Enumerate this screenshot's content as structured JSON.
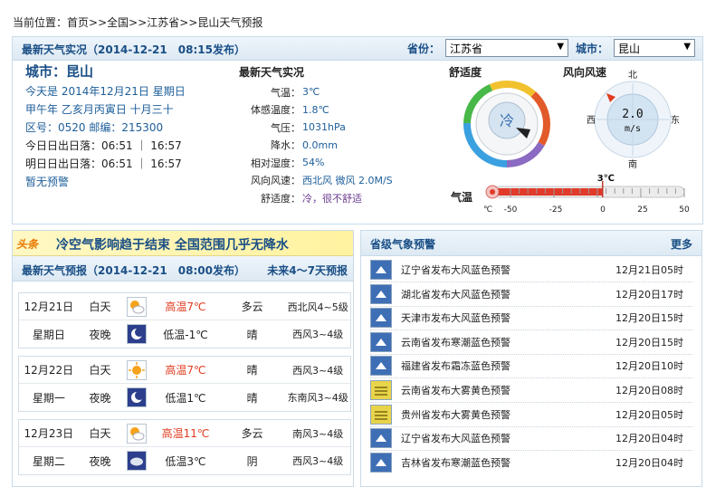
{
  "breadcrumb": {
    "prefix": "当前位置：",
    "items": [
      "首页",
      "全国",
      "江苏省",
      "昆山天气预报"
    ],
    "separator": ">>"
  },
  "current": {
    "title": "最新天气实况（2014-12-21　08:15发布）",
    "province_label": "省份：",
    "province_value": "江苏省",
    "city_label": "城市：",
    "city_value": "昆山",
    "city_heading": "城市：昆山",
    "today": "今天是 2014年12月21日 星期日",
    "lunar": "甲午年 乙亥月丙寅日 十月三十",
    "codes": "区号：0520  邮编：215300",
    "today_sun": "今日日出日落：06:51 ｜ 16:57",
    "tomorrow_sun": "明日日出日落：06:51 ｜ 16:57",
    "warning": "暂无预警",
    "obs_title": "最新天气实况",
    "obs": [
      {
        "k": "气温：",
        "v": "3℃"
      },
      {
        "k": "体感温度：",
        "v": "1.8℃"
      },
      {
        "k": "气压：",
        "v": "1031hPa"
      },
      {
        "k": "降水：",
        "v": "0.0mm"
      },
      {
        "k": "相对湿度：",
        "v": "54%"
      },
      {
        "k": "风向风速：",
        "v": "西北风 微风 2.0M/S"
      },
      {
        "k": "舒适度：",
        "v": "冷，很不舒适"
      }
    ],
    "comfort_title": "舒适度",
    "comfort_value": "冷",
    "wind_title": "风向风速",
    "wind_speed": "2.0",
    "wind_unit": "m/s",
    "compass": {
      "n": "北",
      "s": "南",
      "e": "东",
      "w": "西"
    },
    "temp_title": "气温",
    "temp_value": "3℃",
    "temp_level": 3,
    "temp_axis": [
      "℃",
      "-50",
      "-25",
      "0",
      "25",
      "50"
    ]
  },
  "news": {
    "tag": "头条",
    "headline": "冷空气影响趋于结束  全国范围几乎无降水"
  },
  "forecast": {
    "title": "最新天气预报（2014-12-21　08:00发布）",
    "more": "未来4～7天预报",
    "days": [
      {
        "date": "12月21日",
        "weekday": "星期日",
        "d": {
          "label": "白天",
          "icon": "partly-cloudy-icon",
          "temp": "高温7℃",
          "wx": "多云",
          "wind": "西北风4~5级"
        },
        "n": {
          "label": "夜晚",
          "icon": "moon-icon",
          "temp": "低温-1℃",
          "wx": "晴",
          "wind": "西风3~4级"
        }
      },
      {
        "date": "12月22日",
        "weekday": "星期一",
        "d": {
          "label": "白天",
          "icon": "sun-icon",
          "temp": "高温7℃",
          "wx": "晴",
          "wind": "西风3~4级"
        },
        "n": {
          "label": "夜晚",
          "icon": "moon-icon",
          "temp": "低温1℃",
          "wx": "晴",
          "wind": "东南风3~4级"
        }
      },
      {
        "date": "12月23日",
        "weekday": "星期二",
        "d": {
          "label": "白天",
          "icon": "partly-cloudy-icon",
          "temp": "高温11℃",
          "wx": "多云",
          "wind": "南风3~4级"
        },
        "n": {
          "label": "夜晚",
          "icon": "cloudy-night-icon",
          "temp": "低温3℃",
          "wx": "阴",
          "wind": "西风3~4级"
        }
      }
    ]
  },
  "alerts": {
    "title": "省级气象预警",
    "more": "更多",
    "items": [
      {
        "text": "辽宁省发布大风蓝色预警",
        "date": "12月21日05时",
        "icon": "wind-warning-icon"
      },
      {
        "text": "湖北省发布大风蓝色预警",
        "date": "12月20日17时",
        "icon": "wind-warning-icon"
      },
      {
        "text": "天津市发布大风蓝色预警",
        "date": "12月20日15时",
        "icon": "wind-warning-icon"
      },
      {
        "text": "云南省发布寒潮蓝色预警",
        "date": "12月20日15时",
        "icon": "cold-wave-warning-icon"
      },
      {
        "text": "福建省发布霜冻蓝色预警",
        "date": "12月20日10时",
        "icon": "frost-warning-icon"
      },
      {
        "text": "云南省发布大雾黄色预警",
        "date": "12月20日08时",
        "icon": "fog-warning-icon"
      },
      {
        "text": "贵州省发布大雾黄色预警",
        "date": "12月20日05时",
        "icon": "fog-warning-icon"
      },
      {
        "text": "辽宁省发布大风蓝色预警",
        "date": "12月20日04时",
        "icon": "wind-warning-icon"
      },
      {
        "text": "吉林省发布寒潮蓝色预警",
        "date": "12月20日04时",
        "icon": "cold-wave-warning-icon"
      }
    ]
  },
  "colors": {
    "brand": "#1a4f86",
    "link": "#1d5e9a",
    "hot": "#e03a1e",
    "warning_blue": "#3e6fb5",
    "warning_yellow": "#e8d44a"
  }
}
